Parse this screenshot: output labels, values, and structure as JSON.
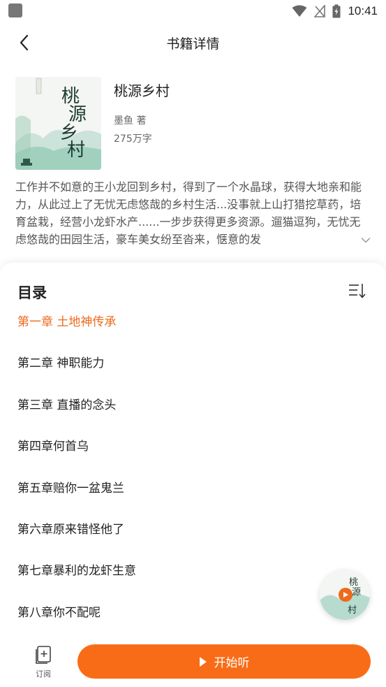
{
  "status_bar": {
    "time": "10:41"
  },
  "nav": {
    "title": "书籍详情"
  },
  "book": {
    "title": "桃源乡村",
    "author": "墨鱼 著",
    "word_count": "275万字",
    "cover_title_chars": [
      "桃",
      "源",
      "乡",
      "村"
    ],
    "description": "工作并不如意的王小龙回到乡村，得到了一个水晶球，获得大地亲和能力，从此过上了无忧无虑悠哉的乡村生活...没事就上山打猎挖草药，培育盆栽，经营小龙虾水产......一步步获得更多资源。遛猫逗狗，无忧无虑悠哉的田园生活，豪车美女纷至沓来，惬意的发"
  },
  "toc": {
    "title": "目录",
    "chapters": [
      "第一章 土地神传承",
      "第二章  神职能力",
      "第三章  直播的念头",
      "第四章何首乌",
      "第五章赔你一盆鬼兰",
      "第六章原来错怪他了",
      "第七章暴利的龙虾生意",
      "第八章你不配呢"
    ]
  },
  "bottom_bar": {
    "subscribe_label": "订阅",
    "listen_label": "开始听"
  },
  "colors": {
    "accent": "#f96c17",
    "active_chapter": "#ee6a1c"
  }
}
